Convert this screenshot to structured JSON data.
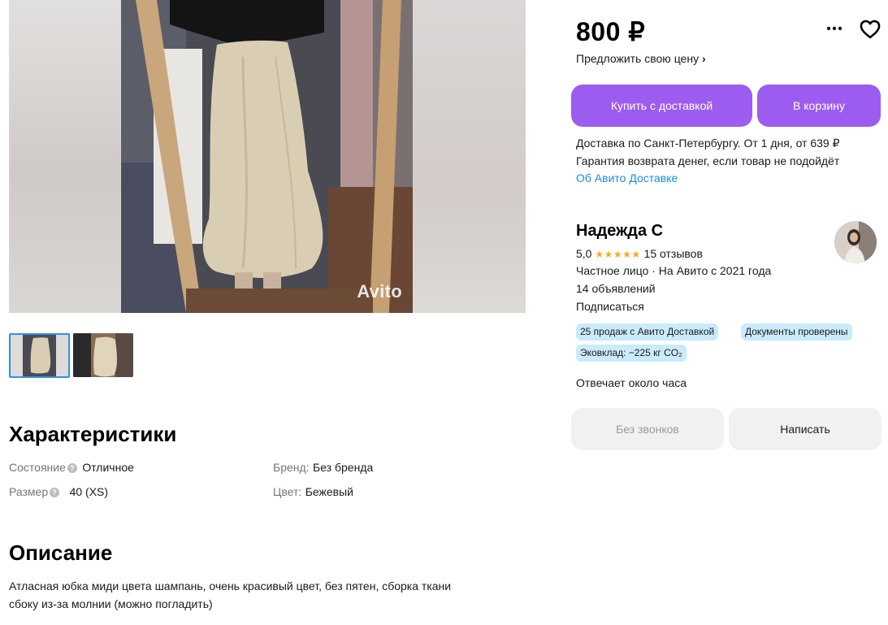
{
  "gallery": {
    "watermark": "Avito",
    "thumbnails": 2
  },
  "characteristics": {
    "title": "Характеристики",
    "left": [
      {
        "label": "Состояние",
        "value": "Отличное",
        "help": true
      },
      {
        "label": "Размер",
        "value": "40 (XS)",
        "help": true
      }
    ],
    "right": [
      {
        "label": "Бренд:",
        "value": "Без бренда"
      },
      {
        "label": "Цвет:",
        "value": "Бежевый"
      }
    ]
  },
  "description": {
    "title": "Описание",
    "text_line1": "Атласная юбка миди цвета шампань, очень красивый цвет, без пятен, сборка ткани",
    "text_line2": "сбоку из-за молнии (можно погладить)"
  },
  "price": {
    "value": "800 ₽",
    "offer_label": "Предложить свою цену",
    "offer_chevron": "›"
  },
  "actions": {
    "buy_label": "Купить с доставкой",
    "cart_label": "В корзину",
    "accent": "#9c5cf0"
  },
  "delivery": {
    "line1": "Доставка по Санкт-Петербургу. От 1 дня, от 639 ₽",
    "line2": "Гарантия возврата денег, если товар не подойдёт",
    "link": "Об Авито Доставке"
  },
  "seller": {
    "name": "Надежда С",
    "rating": "5,0",
    "stars": "★★★★★",
    "reviews": "15 отзывов",
    "type_line": "Частное лицо · На Авито с 2021 года",
    "listings": "14 объявлений",
    "subscribe": "Подписаться",
    "badges": [
      "25 продаж с Авито Доставкой",
      "Документы проверены",
      "Эковклад: −225 кг CO₂"
    ],
    "response": "Отвечает около часа"
  },
  "contact": {
    "no_calls": "Без звонков",
    "write": "Написать"
  },
  "icons": {
    "more": "more-icon",
    "favorite": "heart-icon"
  }
}
